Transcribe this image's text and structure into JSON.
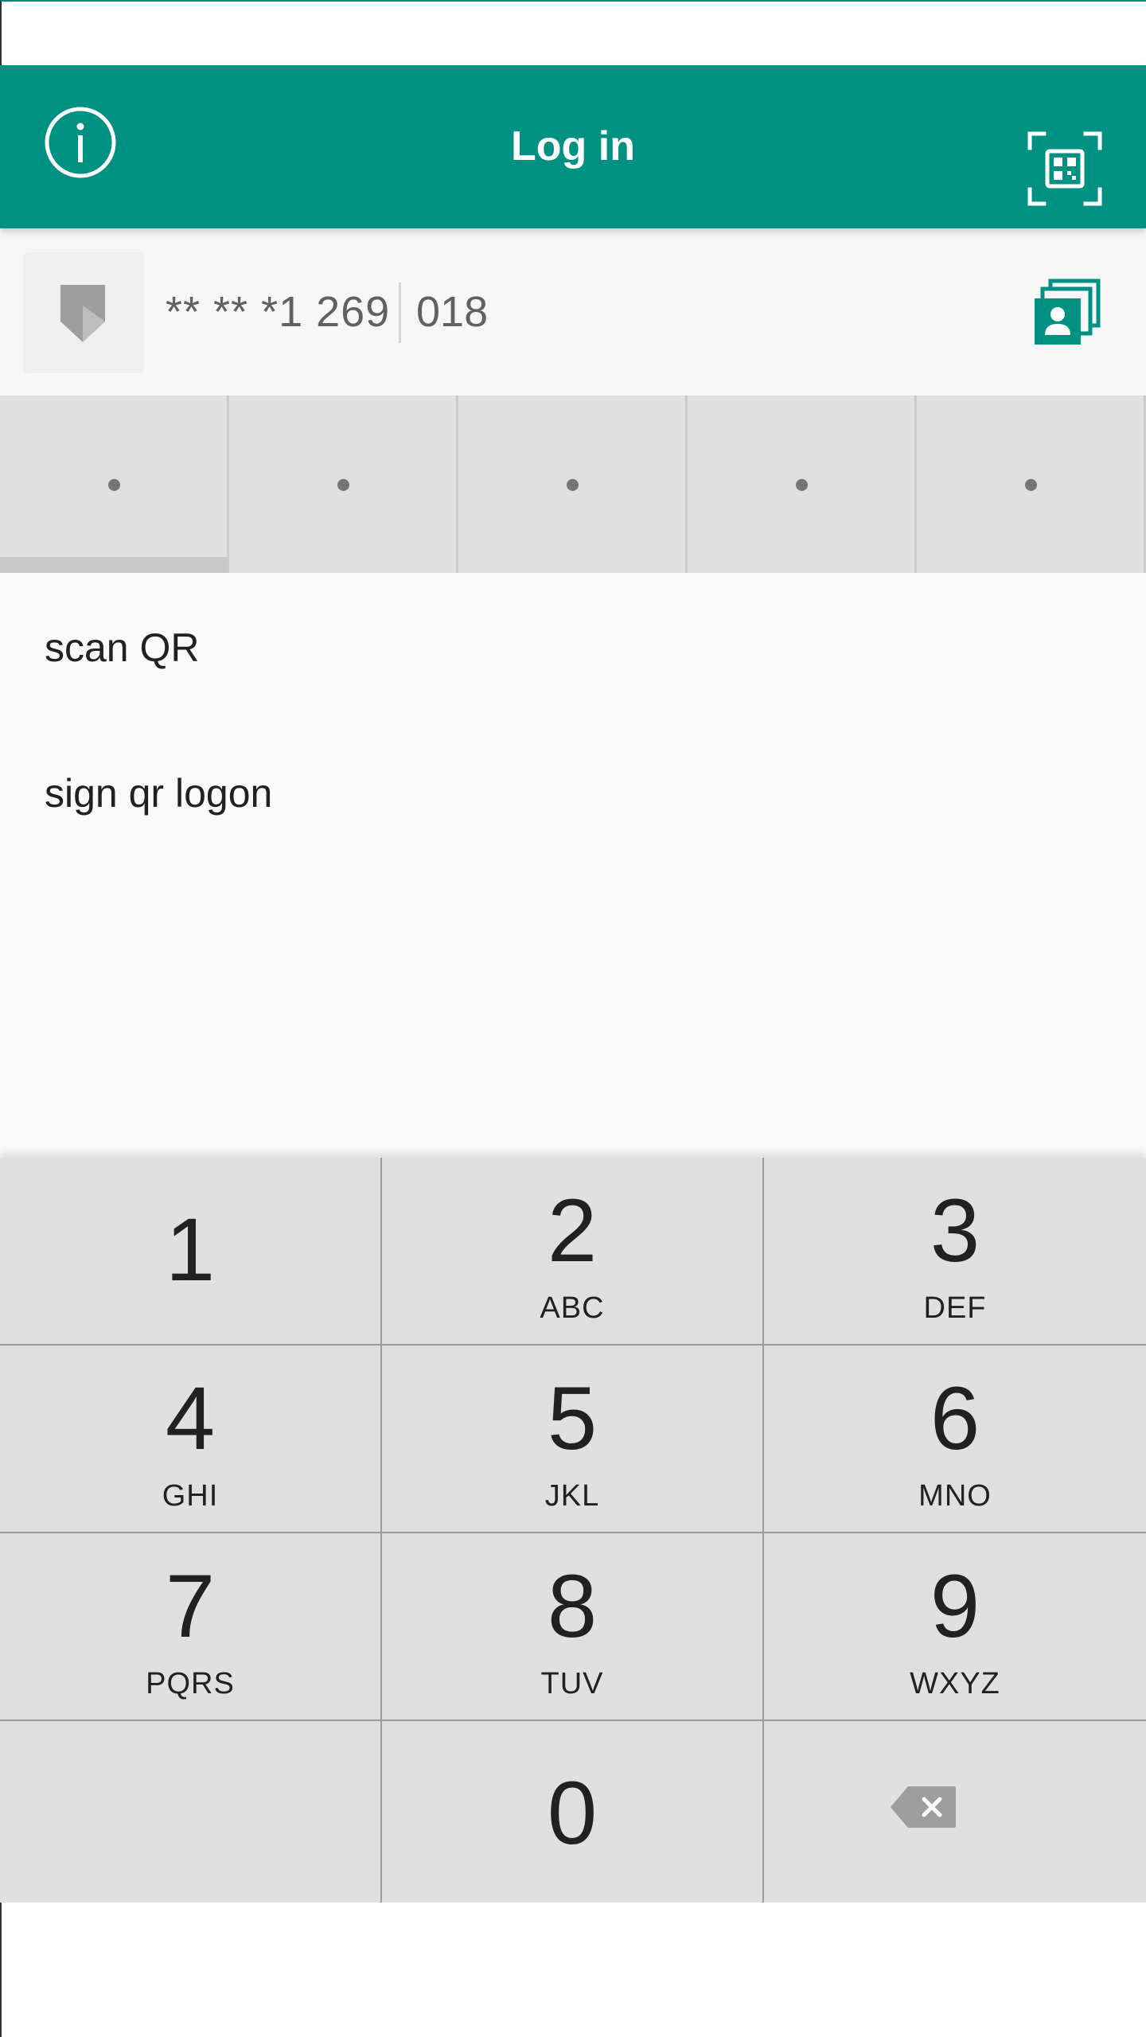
{
  "app_bar": {
    "title": "Log in",
    "info_icon": "info-icon",
    "scan_icon": "qr-scan-icon",
    "color": "#009183"
  },
  "account": {
    "number_masked": "** ** *1 269",
    "suffix": "018",
    "shield_icon": "shield-icon",
    "accounts_icon": "accounts-stack-icon"
  },
  "pin": {
    "length": 5,
    "active_index": 0
  },
  "links": {
    "scan_qr": "scan QR",
    "sign_qr_logon": "sign qr logon"
  },
  "keypad": {
    "keys": [
      {
        "digit": "1",
        "letters": ""
      },
      {
        "digit": "2",
        "letters": "ABC"
      },
      {
        "digit": "3",
        "letters": "DEF"
      },
      {
        "digit": "4",
        "letters": "GHI"
      },
      {
        "digit": "5",
        "letters": "JKL"
      },
      {
        "digit": "6",
        "letters": "MNO"
      },
      {
        "digit": "7",
        "letters": "PQRS"
      },
      {
        "digit": "8",
        "letters": "TUV"
      },
      {
        "digit": "9",
        "letters": "WXYZ"
      },
      {
        "digit": "",
        "letters": ""
      },
      {
        "digit": "0",
        "letters": ""
      },
      {
        "digit": "",
        "letters": "",
        "icon": "backspace-icon"
      }
    ]
  }
}
